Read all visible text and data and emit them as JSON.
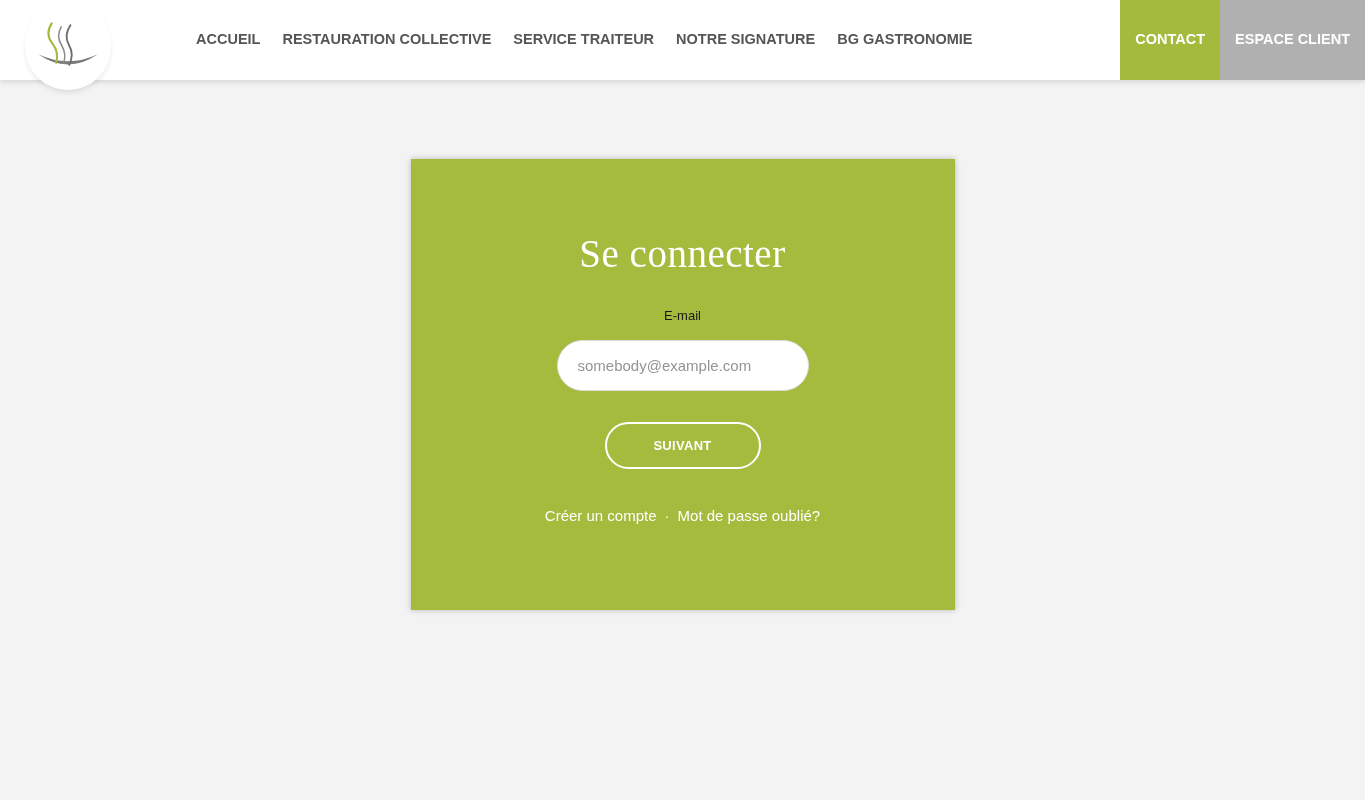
{
  "header": {
    "nav": [
      {
        "label": "ACCUEIL"
      },
      {
        "label": "RESTAURATION COLLECTIVE"
      },
      {
        "label": "SERVICE TRAITEUR"
      },
      {
        "label": "NOTRE SIGNATURE"
      },
      {
        "label": "BG GASTRONOMIE"
      }
    ],
    "buttons": [
      {
        "label": "CONTACT",
        "color": "#a3bb3c"
      },
      {
        "label": "ESPACE CLIENT",
        "color": "#b0b0b0"
      }
    ]
  },
  "login": {
    "title": "Se connecter",
    "email": {
      "label": "E-mail",
      "placeholder": "somebody@example.com"
    },
    "submit": "SUIVANT",
    "links": [
      "Créer un compte",
      "Mot de passe oublié?"
    ],
    "separator": "·"
  }
}
